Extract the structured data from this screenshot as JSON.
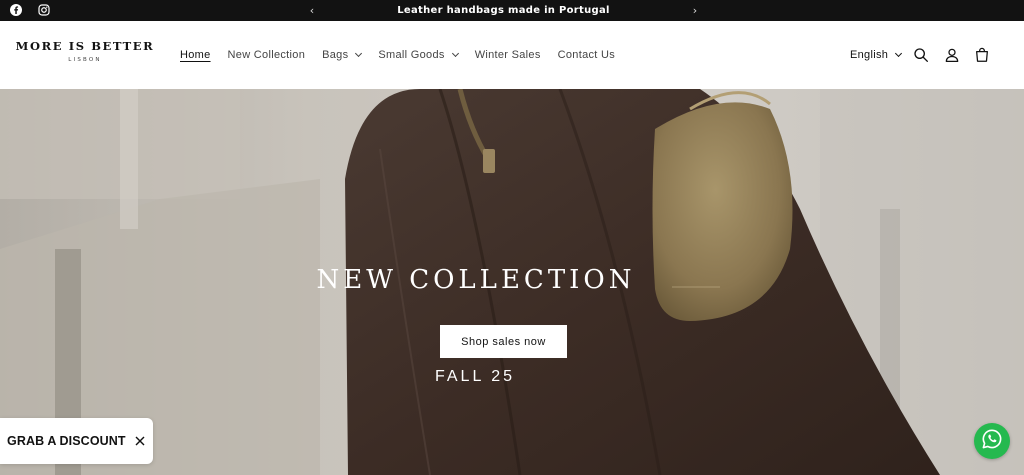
{
  "announcement": {
    "text": "Leather handbags made in Portugal",
    "social_icons": [
      "facebook-icon",
      "instagram-icon"
    ]
  },
  "header": {
    "logo_brand": "MORE IS BETTER",
    "logo_sub": "LISBON",
    "nav": [
      {
        "label": "Home",
        "active": true,
        "dropdown": false
      },
      {
        "label": "New Collection",
        "active": false,
        "dropdown": false
      },
      {
        "label": "Bags",
        "active": false,
        "dropdown": true
      },
      {
        "label": "Small Goods",
        "active": false,
        "dropdown": true
      },
      {
        "label": "Winter Sales",
        "active": false,
        "dropdown": false
      },
      {
        "label": "Contact Us",
        "active": false,
        "dropdown": false
      }
    ],
    "language": "English",
    "icons": [
      "search-icon",
      "account-icon",
      "cart-icon"
    ]
  },
  "hero": {
    "title": "NEW COLLECTION",
    "button_label": "Shop sales now",
    "subtitle": "FALL 25"
  },
  "popup": {
    "discount_label": "GRAB A DISCOUNT"
  },
  "colors": {
    "topbar_bg": "#121212",
    "whatsapp_green": "#25b94f"
  }
}
